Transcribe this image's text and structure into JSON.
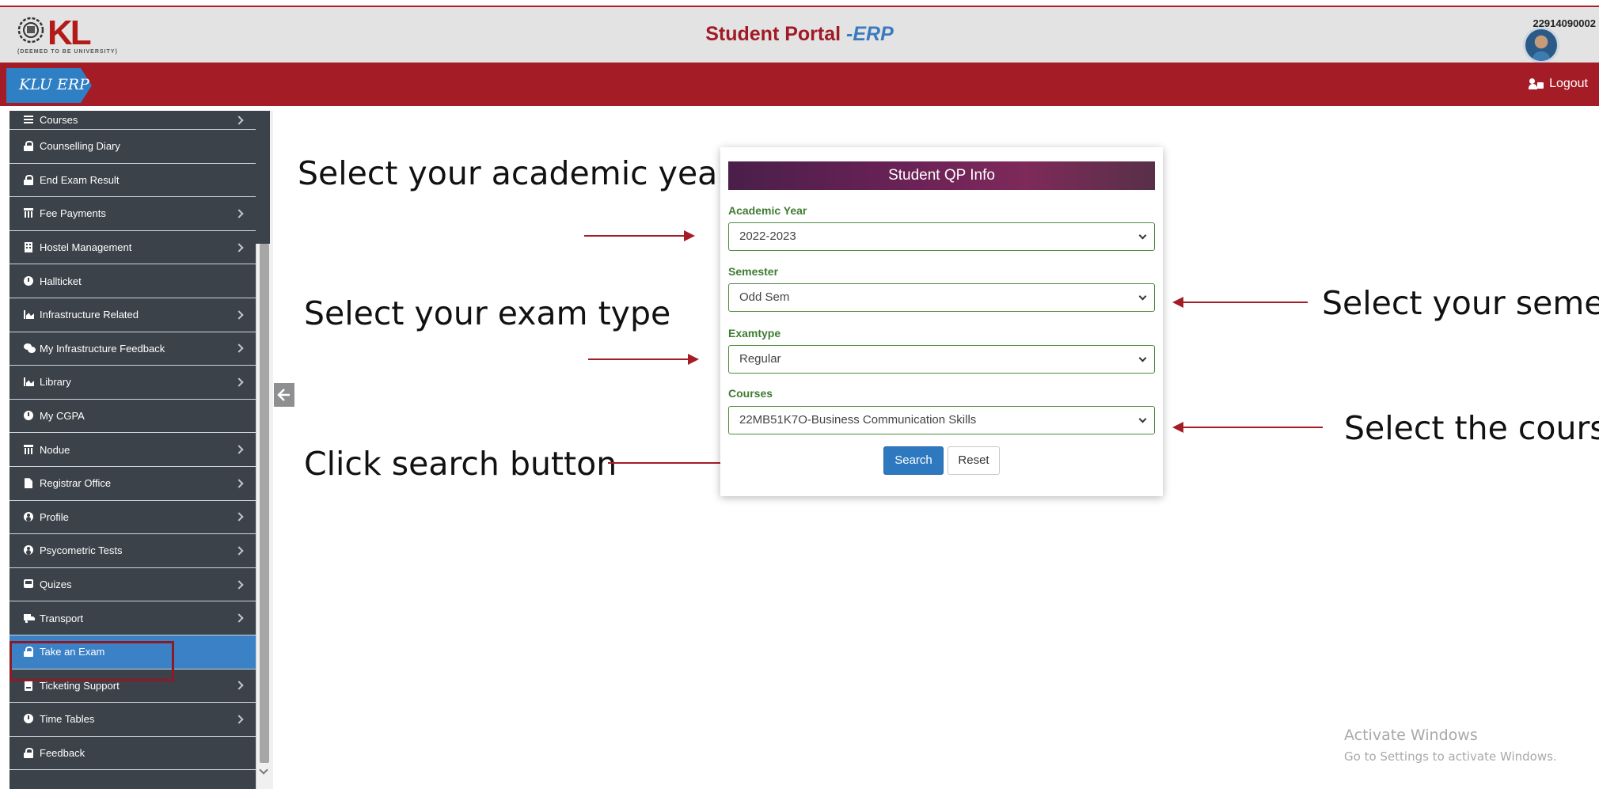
{
  "header": {
    "title_main": "Student Portal",
    "title_suffix": "-ERP",
    "user_id": "22914090002",
    "logo_text": "KL",
    "logo_subtext": "(DEEMED TO BE UNIVERSITY)"
  },
  "navbar": {
    "brand": "KLU ERP",
    "logout": "Logout"
  },
  "sidebar": {
    "items": [
      {
        "label": "Courses",
        "icon": "list-icon",
        "chevron": true
      },
      {
        "label": "Counselling Diary",
        "icon": "lock-icon",
        "chevron": false
      },
      {
        "label": "End Exam Result",
        "icon": "lock-icon",
        "chevron": false
      },
      {
        "label": "Fee Payments",
        "icon": "bank-icon",
        "chevron": true
      },
      {
        "label": "Hostel Management",
        "icon": "building-icon",
        "chevron": true
      },
      {
        "label": "Hallticket",
        "icon": "clock-icon",
        "chevron": false
      },
      {
        "label": "Infrastructure Related",
        "icon": "chart-icon",
        "chevron": true
      },
      {
        "label": "My Infrastructure Feedback",
        "icon": "comments-icon",
        "chevron": true
      },
      {
        "label": "Library",
        "icon": "chart-icon",
        "chevron": true
      },
      {
        "label": "My CGPA",
        "icon": "clock-icon",
        "chevron": false
      },
      {
        "label": "Nodue",
        "icon": "bank-icon",
        "chevron": true
      },
      {
        "label": "Registrar Office",
        "icon": "file-icon",
        "chevron": true
      },
      {
        "label": "Profile",
        "icon": "user-circle-icon",
        "chevron": true
      },
      {
        "label": "Psycometric Tests",
        "icon": "user-circle-icon",
        "chevron": true
      },
      {
        "label": "Quizes",
        "icon": "bus-icon",
        "chevron": true
      },
      {
        "label": "Transport",
        "icon": "truck-icon",
        "chevron": true
      },
      {
        "label": "Take an Exam",
        "icon": "lock-icon",
        "chevron": false,
        "active": true
      },
      {
        "label": "Ticketing Support",
        "icon": "ticket-icon",
        "chevron": true
      },
      {
        "label": "Time Tables",
        "icon": "clock-icon",
        "chevron": true
      },
      {
        "label": "Feedback",
        "icon": "lock-icon",
        "chevron": false
      }
    ]
  },
  "form": {
    "title": "Student QP Info",
    "academic_year_label": "Academic Year",
    "academic_year_value": "2022-2023",
    "semester_label": "Semester",
    "semester_value": "Odd Sem",
    "examtype_label": "Examtype",
    "examtype_value": "Regular",
    "courses_label": "Courses",
    "courses_value": "22MB51K7O-Business Communication Skills",
    "search_label": "Search",
    "reset_label": "Reset"
  },
  "annotations": {
    "academic_year": "Select your academic year",
    "exam_type": "Select your exam type",
    "search": "Click search button",
    "semester": "Select your semes",
    "course": "Select the course"
  },
  "watermark": {
    "line1": "Activate Windows",
    "line2": "Go to Settings to activate Windows."
  },
  "colors": {
    "navbar": "#a41c26",
    "brand": "#2f7fc4",
    "sidebar": "#3b4249",
    "active_item": "#3a81c6",
    "label_green": "#3e7c32",
    "search_button": "#2e78bf"
  }
}
